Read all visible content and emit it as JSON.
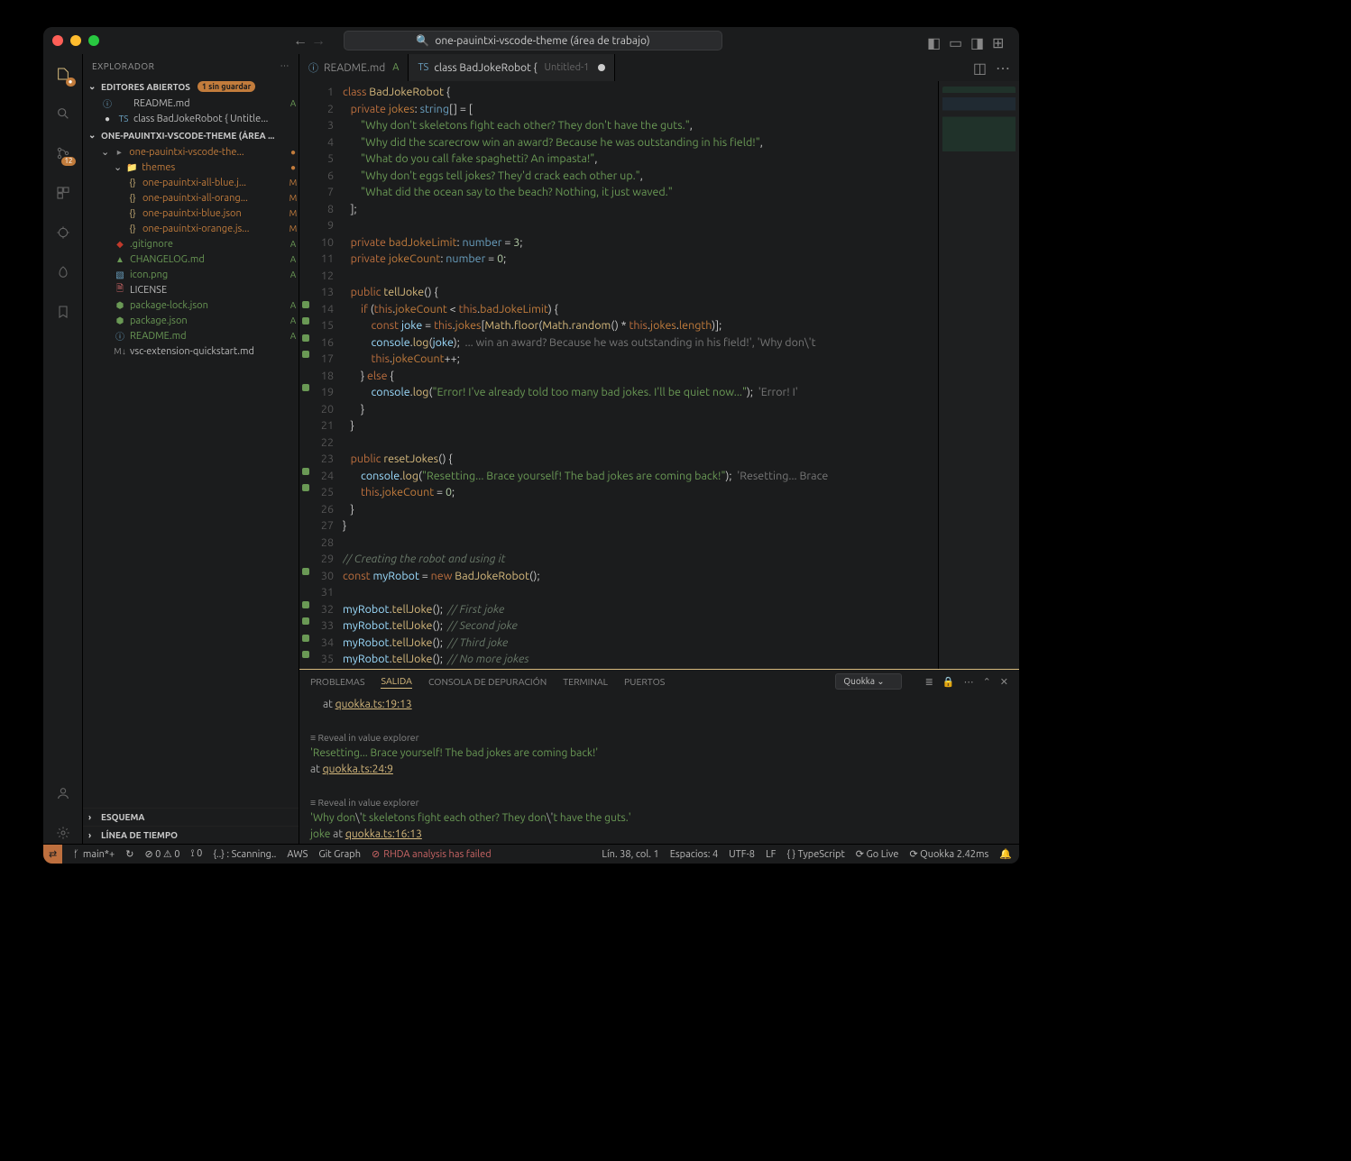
{
  "titlebar": {
    "search_label": "one-pauintxi-vscode-theme (área de trabajo)"
  },
  "activitybar": {
    "scm_badge": "12"
  },
  "sidebar": {
    "title": "EXPLORADOR",
    "open_editors_label": "EDITORES ABIERTOS",
    "unsaved_badge": "1 sin guardar",
    "open_editors": [
      {
        "icon": "ⓘ",
        "name": "README.md",
        "status": "A",
        "dirty": false
      },
      {
        "icon": "TS",
        "name": "class BadJokeRobot { Untitle...",
        "status": "",
        "dirty": true
      }
    ],
    "workspace_label": "ONE-PAUINTXI-VSCODE-THEME (ÁREA ...",
    "tree": [
      {
        "depth": 1,
        "icon": "▸",
        "iconColor": "#888",
        "name": "one-pauintxi-vscode-the...",
        "status": "●",
        "statusClass": "m",
        "folder": true,
        "open": true
      },
      {
        "depth": 2,
        "icon": "📁",
        "iconColor": "#d7ba7d",
        "name": "themes",
        "status": "●",
        "statusClass": "m",
        "folder": true,
        "open": true
      },
      {
        "depth": 3,
        "icon": "{}",
        "iconColor": "#d7ba7d",
        "name": "one-pauintxi-all-blue.j...",
        "status": "M",
        "statusClass": "m"
      },
      {
        "depth": 3,
        "icon": "{}",
        "iconColor": "#d7ba7d",
        "name": "one-pauintxi-all-orang...",
        "status": "M",
        "statusClass": "m"
      },
      {
        "depth": 3,
        "icon": "{}",
        "iconColor": "#d7ba7d",
        "name": "one-pauintxi-blue.json",
        "status": "M",
        "statusClass": "m"
      },
      {
        "depth": 3,
        "icon": "{}",
        "iconColor": "#d7ba7d",
        "name": "one-pauintxi-orange.js...",
        "status": "M",
        "statusClass": "m"
      },
      {
        "depth": 2,
        "icon": "◆",
        "iconColor": "#c0392b",
        "name": ".gitignore",
        "status": "A",
        "statusClass": "a"
      },
      {
        "depth": 2,
        "icon": "▲",
        "iconColor": "#6a9955",
        "name": "CHANGELOG.md",
        "status": "A",
        "statusClass": "a"
      },
      {
        "depth": 2,
        "icon": "▧",
        "iconColor": "#6aa0c0",
        "name": "icon.png",
        "status": "A",
        "statusClass": "a"
      },
      {
        "depth": 2,
        "icon": "🗎",
        "iconColor": "#cc6666",
        "name": "LICENSE",
        "status": "",
        "statusClass": ""
      },
      {
        "depth": 2,
        "icon": "⬢",
        "iconColor": "#6a9955",
        "name": "package-lock.json",
        "status": "A",
        "statusClass": "a"
      },
      {
        "depth": 2,
        "icon": "⬢",
        "iconColor": "#6a9955",
        "name": "package.json",
        "status": "A",
        "statusClass": "a"
      },
      {
        "depth": 2,
        "icon": "ⓘ",
        "iconColor": "#6aa0c0",
        "name": "README.md",
        "status": "A",
        "statusClass": "a"
      },
      {
        "depth": 2,
        "icon": "M↓",
        "iconColor": "#888",
        "name": "vsc-extension-quickstart.md",
        "status": "",
        "statusClass": ""
      }
    ],
    "outline_label": "ESQUEMA",
    "timeline_label": "LÍNEA DE TIEMPO"
  },
  "tabs": [
    {
      "icon": "ⓘ",
      "iconColor": "#6aa0c0",
      "name": "README.md",
      "suffix": "A",
      "suffixColor": "#6a9955",
      "dirty": false,
      "active": false
    },
    {
      "icon": "TS",
      "iconColor": "#6aa0c0",
      "name": "class BadJokeRobot {",
      "suffix": "Untitled-1",
      "suffixColor": "#666",
      "dirty": true,
      "active": true
    }
  ],
  "code": {
    "lines": 35,
    "squares_on": [
      14,
      15,
      16,
      17,
      19,
      24,
      25,
      30,
      32,
      33,
      34,
      35
    ]
  },
  "panel": {
    "tabs": {
      "problems": "PROBLEMAS",
      "output": "SALIDA",
      "debug": "CONSOLA DE DEPURACIÓN",
      "terminal": "TERMINAL",
      "ports": "PUERTOS"
    },
    "select_value": "Quokka",
    "lines": [
      {
        "t": "loc",
        "text": "at ",
        "link": "quokka.ts:19:13"
      },
      {
        "t": "sp"
      },
      {
        "t": "reveal",
        "text": "Reveal in value explorer"
      },
      {
        "t": "str",
        "text": "'Resetting... Brace yourself! The bad jokes are coming back!'"
      },
      {
        "t": "loc",
        "text": "  at ",
        "link": "quokka.ts:24:9"
      },
      {
        "t": "sp"
      },
      {
        "t": "reveal",
        "text": "Reveal in value explorer"
      },
      {
        "t": "strmix",
        "pre": "'Why don",
        "esc": "\\'",
        "mid": "t skeletons fight each other? They don",
        "esc2": "\\'",
        "post": "t have the guts.'"
      },
      {
        "t": "loc",
        "text": "  at ",
        "pre": "joke ",
        "link": "quokka.ts:16:13"
      }
    ]
  },
  "statusbar": {
    "branch": "main*+",
    "sync": "↻",
    "problems": "⊘ 0 ⚠ 0",
    "radio": "⟟ 0",
    "scanning": "{..} : Scanning..",
    "aws": "AWS",
    "gitgraph": "Git Graph",
    "rhda": "RHDA analysis has failed",
    "cursor": "Lín. 38, col. 1",
    "spaces": "Espacios: 4",
    "encoding": "UTF-8",
    "eol": "LF",
    "lang": "{ } TypeScript",
    "golive": "⟳ Go Live",
    "quokka": "⟳ Quokka 2.42ms",
    "bell": "🔔"
  }
}
